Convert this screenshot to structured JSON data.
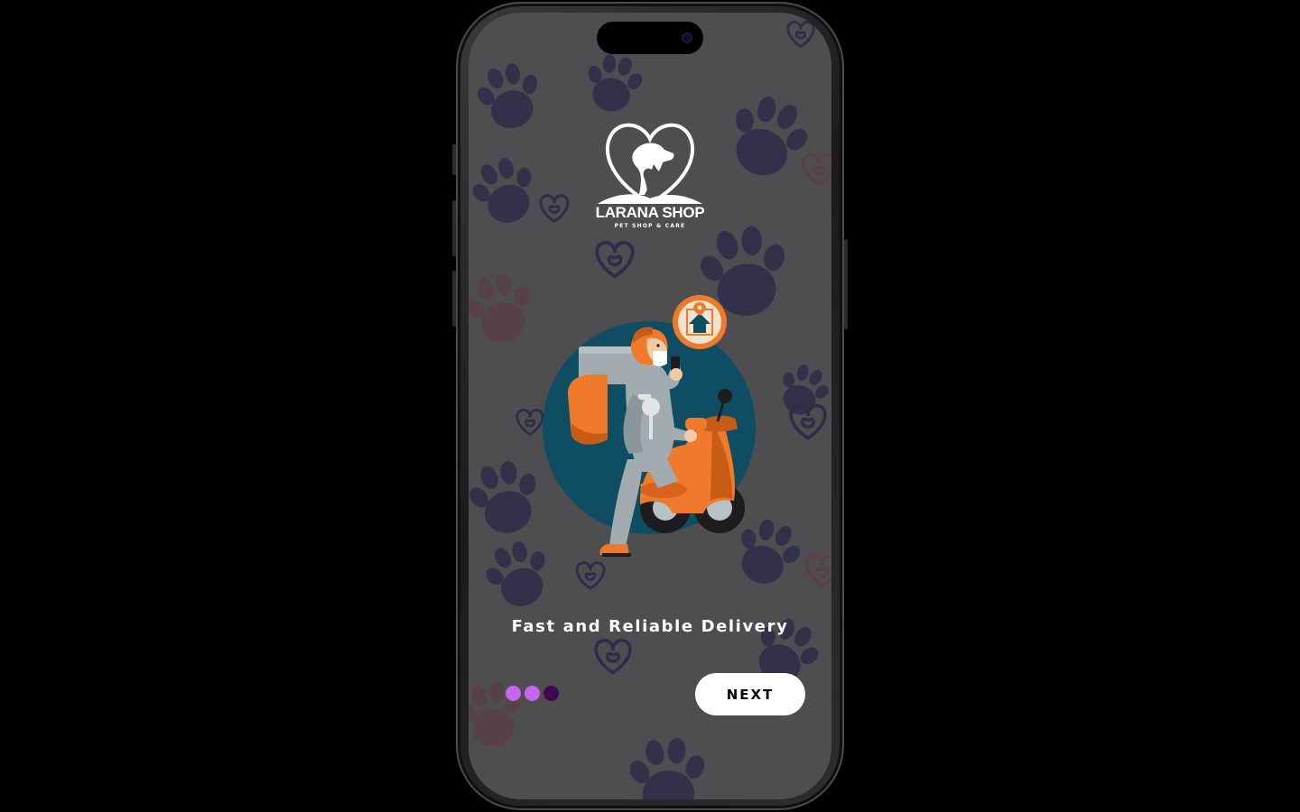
{
  "brand": {
    "name": "LARANA SHOP",
    "tagline": "PET SHOP & CARE"
  },
  "onboarding": {
    "headline": "Fast and Reliable Delivery",
    "next_label": "NEXT",
    "pager": {
      "total": 3,
      "active_color": "#c366f0",
      "inactive_color": "#3d0a4d"
    }
  },
  "colors": {
    "screen_bg": "#4e4e50",
    "paw_print": "#33304a",
    "paw_print_warm": "#5a3f48",
    "heart_outline": "#2f2c48",
    "scooter_orange": "#f07a2c",
    "illustration_circle": "#0f4d63"
  },
  "icons": {
    "logo": "heart-dog-cat-logo",
    "illustration": "delivery-scooter-rider",
    "map_pin": "location-pin-icon"
  }
}
